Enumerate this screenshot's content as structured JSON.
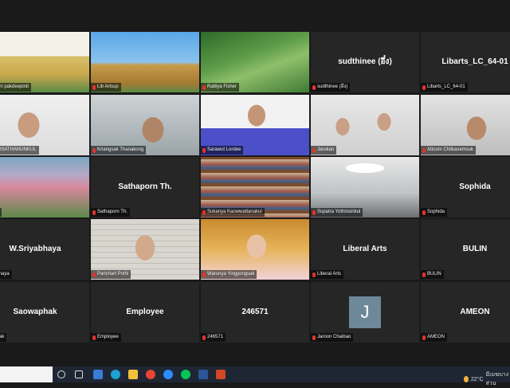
{
  "window": {
    "title": ""
  },
  "tiles": [
    {
      "id": "t1",
      "label": "...ssorn pakdeepinit",
      "center": "",
      "photo_style": "banner"
    },
    {
      "id": "t2",
      "label": "Lib Artsup",
      "center": "",
      "photo_style": "temple"
    },
    {
      "id": "t3",
      "label": "Rattiya Fisher",
      "center": "",
      "photo_style": "forest"
    },
    {
      "id": "t4",
      "label": "sudthinee (อึ๋ง)",
      "center": "sudthinee (อึ๋ง)",
      "photo_style": ""
    },
    {
      "id": "t5",
      "label": "Libarts_LC_64-01",
      "center": "Libarts_LC_64-01",
      "photo_style": ""
    },
    {
      "id": "t6",
      "label": "...IN OSATHANUNKUL",
      "center": "",
      "photo_style": "person-light"
    },
    {
      "id": "t7",
      "label": "Kriangsak Thanakong",
      "center": "",
      "photo_style": "person-room"
    },
    {
      "id": "t8",
      "label": "Sarawut Lordee",
      "center": "",
      "photo_style": "person-blue"
    },
    {
      "id": "t9",
      "label": "Jarukan",
      "center": "",
      "photo_style": "two-people"
    },
    {
      "id": "t10",
      "label": "Attcom Chitkasemsuk",
      "center": "",
      "photo_style": "person-headset"
    },
    {
      "id": "t11",
      "label": "...a P.",
      "center": "",
      "photo_style": "lotus"
    },
    {
      "id": "t12",
      "label": "Sathaporn Th.",
      "center": "Sathaporn Th.",
      "photo_style": ""
    },
    {
      "id": "t13",
      "label": "Sukanya Kaowwattanakul",
      "center": "",
      "photo_style": "library"
    },
    {
      "id": "t14",
      "label": "Supatra Yothinsirikul",
      "center": "",
      "photo_style": "office"
    },
    {
      "id": "t15",
      "label": "Sophida",
      "center": "Sophida",
      "photo_style": ""
    },
    {
      "id": "t16",
      "label": "...yabhaya",
      "center": "W.Sriyabhaya",
      "photo_style": ""
    },
    {
      "id": "t17",
      "label": "Parichart Pothi",
      "center": "",
      "photo_style": "person-brick",
      "active": true
    },
    {
      "id": "t18",
      "label": "Warunya Yingyongsak",
      "center": "",
      "photo_style": "person-pink"
    },
    {
      "id": "t19",
      "label": "Liberal Arts",
      "center": "Liberal Arts",
      "photo_style": ""
    },
    {
      "id": "t20",
      "label": "BULIN",
      "center": "BULIN",
      "photo_style": ""
    },
    {
      "id": "t21",
      "label": "...aphak",
      "center": "Saowaphak",
      "photo_style": ""
    },
    {
      "id": "t22",
      "label": "Employee",
      "center": "Employee",
      "photo_style": ""
    },
    {
      "id": "t23",
      "label": "246571",
      "center": "246571",
      "photo_style": ""
    },
    {
      "id": "t24",
      "label": "Jaroon Chaibao",
      "center": "",
      "photo_style": "avatar",
      "avatar_letter": "J"
    },
    {
      "id": "t25",
      "label": "AMEON",
      "center": "AMEON",
      "photo_style": ""
    }
  ],
  "taskbar": {
    "temperature": "22°C",
    "weather_text": "มีเมฆบางส่วน"
  },
  "colors": {
    "active_border": "#b8e05a",
    "tile_bg": "#262626",
    "mic_muted": "#e5322d"
  }
}
